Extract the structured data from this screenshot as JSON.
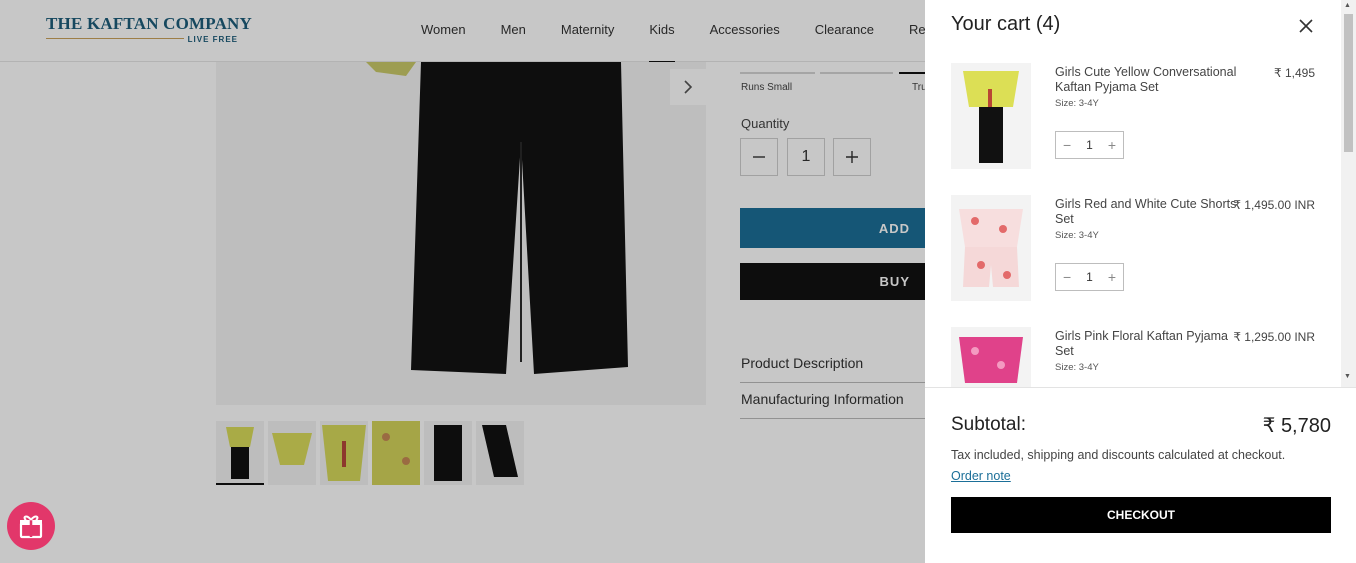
{
  "brand": {
    "name": "THE KAFTAN COMPANY",
    "tagline": "LIVE FREE"
  },
  "nav": [
    "Women",
    "Men",
    "Maternity",
    "Kids",
    "Accessories",
    "Clearance",
    "Rewards"
  ],
  "product": {
    "runs_small": "Runs Small",
    "true_fit_partial": "Tru",
    "quantity_label": "Quantity",
    "quantity": "1",
    "add_label": "ADD",
    "buy_label": "BUY",
    "accordion": [
      "Product Description",
      "Manufacturing Information"
    ]
  },
  "cart": {
    "title": "Your cart (4)",
    "items": [
      {
        "title": "Girls Cute Yellow Conversational Kaftan Pyjama Set",
        "size": "Size: 3-4Y",
        "price": "₹ 1,495",
        "qty": "1"
      },
      {
        "title": "Girls Red and White Cute Shorts Set",
        "size": "Size: 3-4Y",
        "price": "₹ 1,495.00 INR",
        "qty": "1"
      },
      {
        "title": "Girls Pink Floral Kaftan Pyjama Set",
        "size": "Size: 3-4Y",
        "price": "₹ 1,295.00 INR",
        "qty": "1"
      }
    ],
    "subtotal_label": "Subtotal:",
    "subtotal_value": "₹ 5,780",
    "tax_note": "Tax included, shipping and discounts calculated at checkout.",
    "order_note": "Order note",
    "checkout_label": "CHECKOUT"
  },
  "colors": {
    "accent": "#1b6f98",
    "gift": "#e2376a"
  }
}
